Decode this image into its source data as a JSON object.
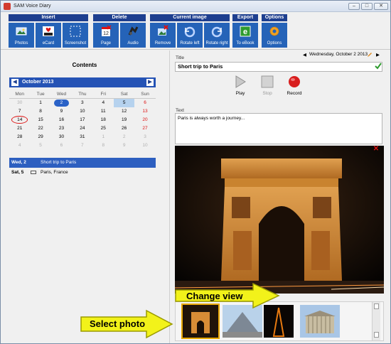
{
  "window": {
    "title": "SAM Voice Diary",
    "controls": [
      "–",
      "□",
      "✕"
    ]
  },
  "toolbar": {
    "groups": [
      {
        "header": "Insert",
        "buttons": [
          {
            "label": "Photos",
            "icon": "photos-icon",
            "glyph": "▣"
          },
          {
            "label": "eCard",
            "icon": "ecard-icon",
            "glyph": "♥",
            "badge": "(NAME)"
          },
          {
            "label": "Screenshot",
            "icon": "screenshot-icon",
            "glyph": "⬚"
          }
        ]
      },
      {
        "header": "Delete",
        "buttons": [
          {
            "label": "Page",
            "icon": "delete-page-icon",
            "glyph": "12"
          },
          {
            "label": "Audio",
            "icon": "delete-audio-icon",
            "glyph": "✦"
          }
        ]
      },
      {
        "header": "Current image",
        "buttons": [
          {
            "label": "Remove",
            "icon": "remove-image-icon",
            "glyph": "✖"
          },
          {
            "label": "Rotate left",
            "icon": "rotate-left-icon",
            "glyph": "↺"
          },
          {
            "label": "Rotate right",
            "icon": "rotate-right-icon",
            "glyph": "↻"
          }
        ]
      },
      {
        "header": "Export",
        "buttons": [
          {
            "label": "To eBook",
            "icon": "ebook-icon",
            "glyph": "e"
          }
        ]
      },
      {
        "header": "Options",
        "buttons": [
          {
            "label": "Options",
            "icon": "gear-icon",
            "glyph": "⚙"
          }
        ]
      }
    ]
  },
  "left": {
    "contents_title": "Contents",
    "calendar": {
      "month_label": "October 2013",
      "prev": "◀",
      "next": "▶",
      "weekdays": [
        "Mon",
        "Tue",
        "Wed",
        "Thu",
        "Fri",
        "Sat",
        "Sun"
      ],
      "weeks": [
        [
          [
            "30",
            "other"
          ],
          [
            "1",
            ""
          ],
          [
            "2",
            "sel"
          ],
          [
            "3",
            ""
          ],
          [
            "4",
            ""
          ],
          [
            "5",
            "hl"
          ],
          [
            "6",
            "sun"
          ]
        ],
        [
          [
            "7",
            ""
          ],
          [
            "8",
            ""
          ],
          [
            "9",
            ""
          ],
          [
            "10",
            ""
          ],
          [
            "11",
            ""
          ],
          [
            "12",
            ""
          ],
          [
            "13",
            "sun"
          ]
        ],
        [
          [
            "14",
            "today"
          ],
          [
            "15",
            ""
          ],
          [
            "16",
            ""
          ],
          [
            "17",
            ""
          ],
          [
            "18",
            ""
          ],
          [
            "19",
            ""
          ],
          [
            "20",
            "sun"
          ]
        ],
        [
          [
            "21",
            ""
          ],
          [
            "22",
            ""
          ],
          [
            "23",
            ""
          ],
          [
            "24",
            ""
          ],
          [
            "25",
            ""
          ],
          [
            "26",
            ""
          ],
          [
            "27",
            "sun"
          ]
        ],
        [
          [
            "28",
            ""
          ],
          [
            "29",
            ""
          ],
          [
            "30",
            ""
          ],
          [
            "31",
            ""
          ],
          [
            "1",
            "other"
          ],
          [
            "2",
            "other"
          ],
          [
            "3",
            "other"
          ]
        ],
        [
          [
            "4",
            "other"
          ],
          [
            "5",
            "other"
          ],
          [
            "6",
            "other"
          ],
          [
            "7",
            "other"
          ],
          [
            "8",
            "other"
          ],
          [
            "9",
            "other"
          ],
          [
            "10",
            "other"
          ]
        ]
      ]
    },
    "entries": [
      {
        "date": "Wed, 2",
        "text": "Short trip to Paris",
        "selected": true
      },
      {
        "date": "Sat, 5",
        "text": "Paris, France",
        "selected": false
      }
    ]
  },
  "right": {
    "title_label": "Title",
    "date_text": "Wednesday, October 2 2013",
    "title_value": "Short trip to Paris",
    "play_label": "Play",
    "stop_label": "Stop",
    "record_label": "Record",
    "text_label": "Text",
    "text_value": "Paris is always worth a journey..."
  },
  "callouts": {
    "change_view": "Change view",
    "select_photo": "Select photo"
  },
  "colors": {
    "accent": "#2563b8",
    "header": "#1e3f8f",
    "callout": "#f2f21a",
    "callout_border": "#9a9a00"
  }
}
